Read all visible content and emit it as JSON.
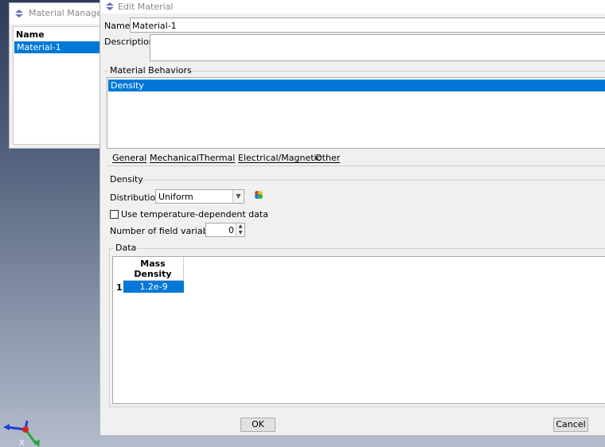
{
  "material_manager": {
    "title": "Material Manager",
    "column_header": "Name",
    "items": [
      "Material-1"
    ]
  },
  "edit_material": {
    "title": "Edit Material",
    "name_label": "Name:",
    "name_value": "Material-1",
    "description_label": "Description:",
    "description_value": "",
    "behaviors_group_label": "Material Behaviors",
    "behaviors": [
      "Density"
    ],
    "menu": [
      "General",
      "Mechanical",
      "Thermal",
      "Electrical/Magnetic",
      "Other"
    ],
    "density_group_label": "Density",
    "distribution_label": "Distribution:",
    "distribution_value": "Uniform",
    "temperature_dependent_label": "Use temperature-dependent data",
    "temperature_dependent_checked": false,
    "field_variables_label": "Number of field variables:",
    "field_variables_value": "0",
    "data_group_label": "Data",
    "table": {
      "column_header_line1": "Mass",
      "column_header_line2": "Density",
      "rows": [
        {
          "index": "1",
          "value": "1.2e-9"
        }
      ]
    },
    "ok_label": "OK",
    "cancel_label": "Cancel"
  },
  "viewport": {
    "triad_axis_label": "X"
  },
  "colors": {
    "selection": "#0078d7",
    "dialog_bg": "#f0f0f0"
  }
}
